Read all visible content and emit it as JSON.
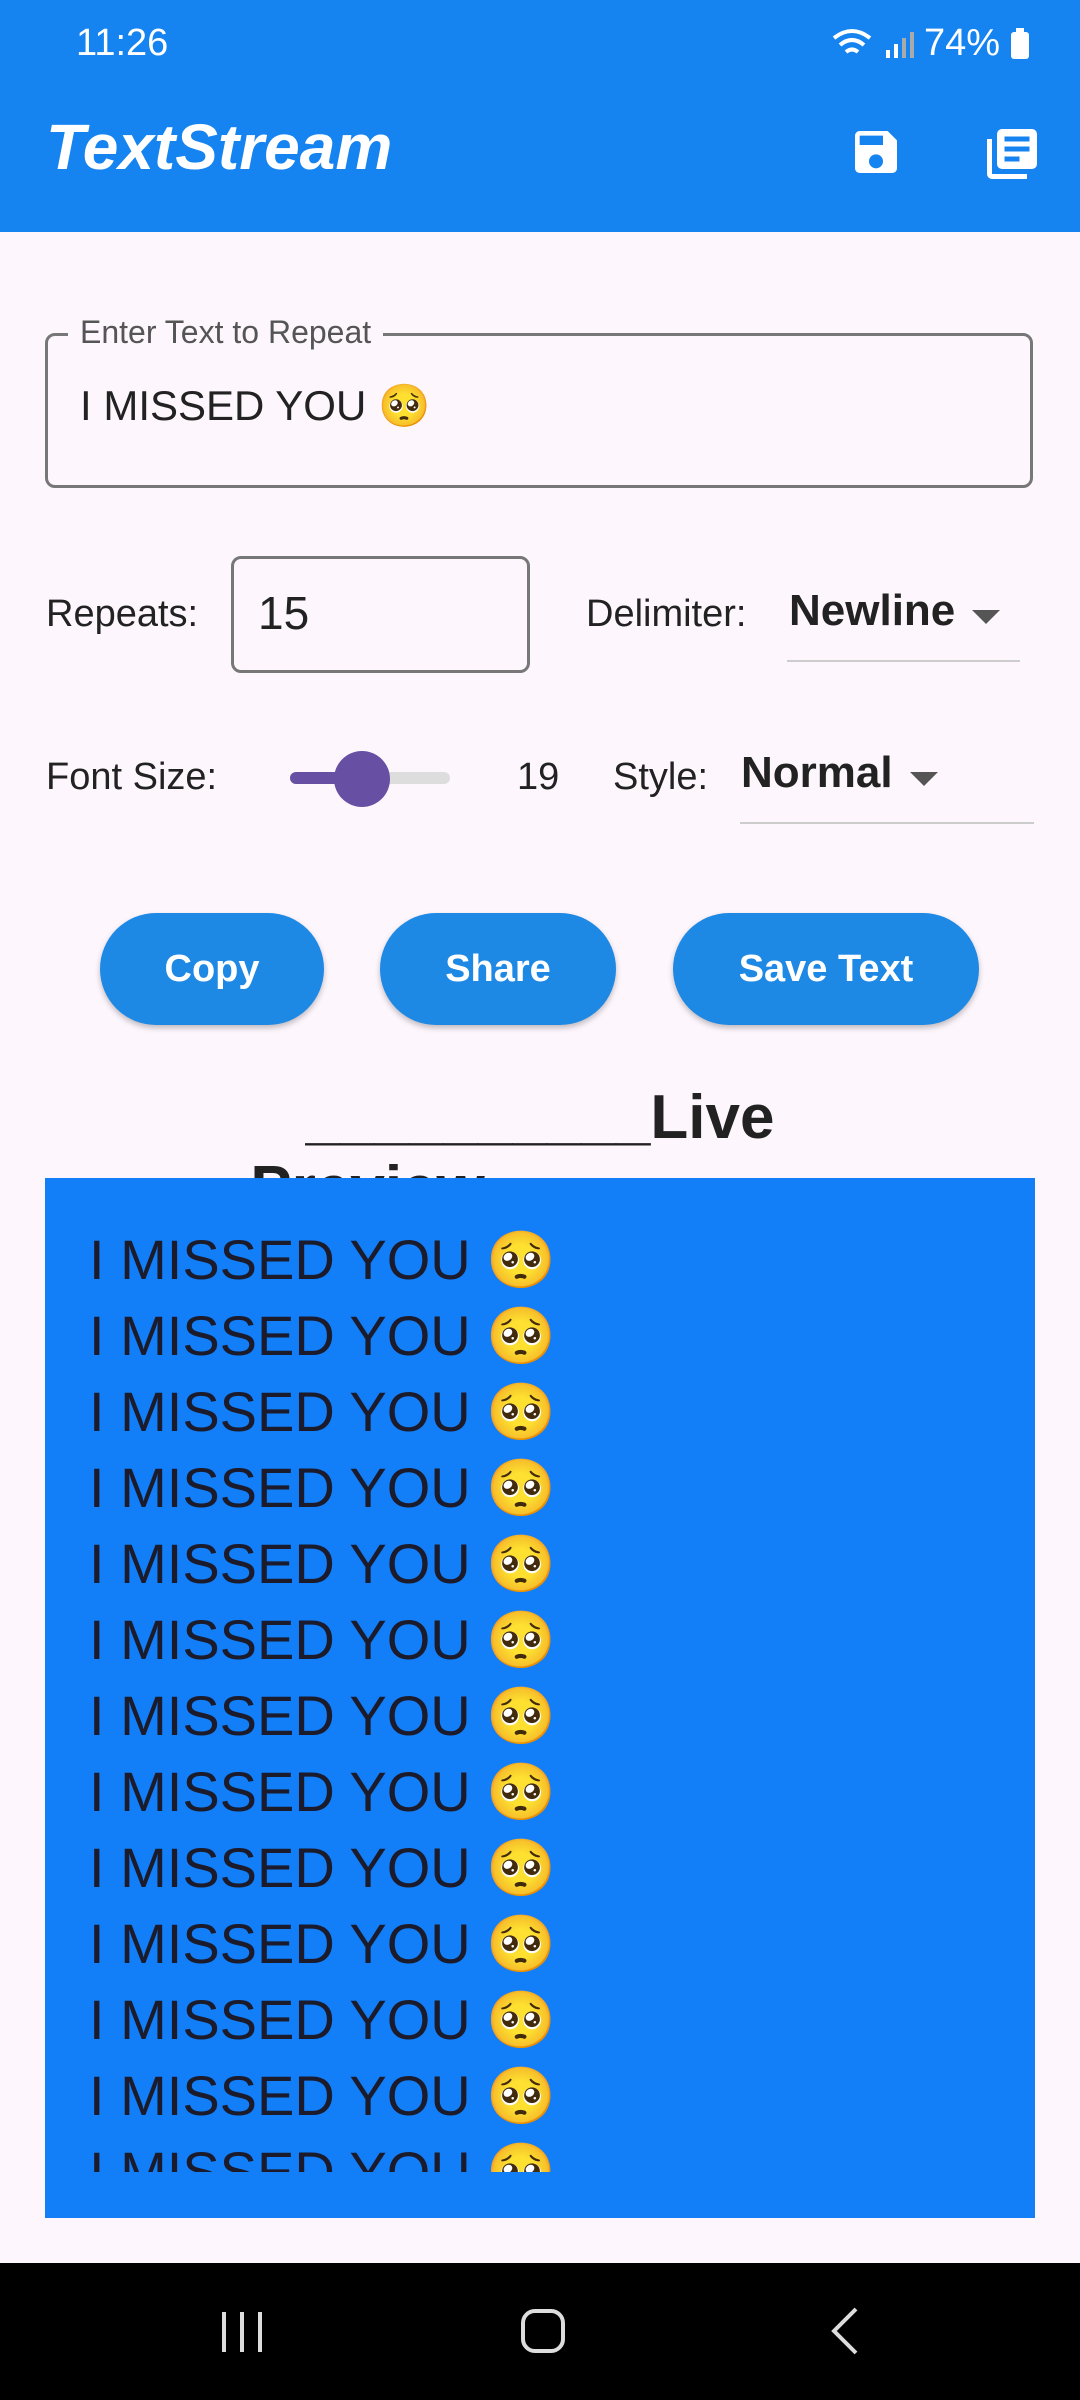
{
  "status_bar": {
    "time": "11:26",
    "battery": "74%"
  },
  "app_bar": {
    "title": "TextStream",
    "icons": [
      "save-icon",
      "library-icon"
    ]
  },
  "form": {
    "text_field": {
      "label": "Enter Text to Repeat",
      "value": "I MISSED YOU 🥺"
    },
    "repeats": {
      "label": "Repeats:",
      "value": "15"
    },
    "delimiter": {
      "label": "Delimiter:",
      "value": "Newline"
    },
    "font_size": {
      "label": "Font Size:",
      "value": "19",
      "slider_fraction": 0.45
    },
    "style": {
      "label": "Style:",
      "value": "Normal"
    }
  },
  "buttons": {
    "copy": "Copy",
    "share": "Share",
    "save_text": "Save Text"
  },
  "preview": {
    "heading": "__________Live Preview__________",
    "lines": [
      "I MISSED YOU 🥺",
      "I MISSED YOU 🥺",
      "I MISSED YOU 🥺",
      "I MISSED YOU 🥺",
      "I MISSED YOU 🥺",
      "I MISSED YOU 🥺",
      "I MISSED YOU 🥺",
      "I MISSED YOU 🥺",
      "I MISSED YOU 🥺",
      "I MISSED YOU 🥺",
      "I MISSED YOU 🥺",
      "I MISSED YOU 🥺",
      "I MISSED YOU 🥺"
    ]
  },
  "colors": {
    "app_bar": "#1583f0",
    "preview_bg": "#127ef8",
    "button": "#1e88e5",
    "slider": "#6750a4"
  }
}
